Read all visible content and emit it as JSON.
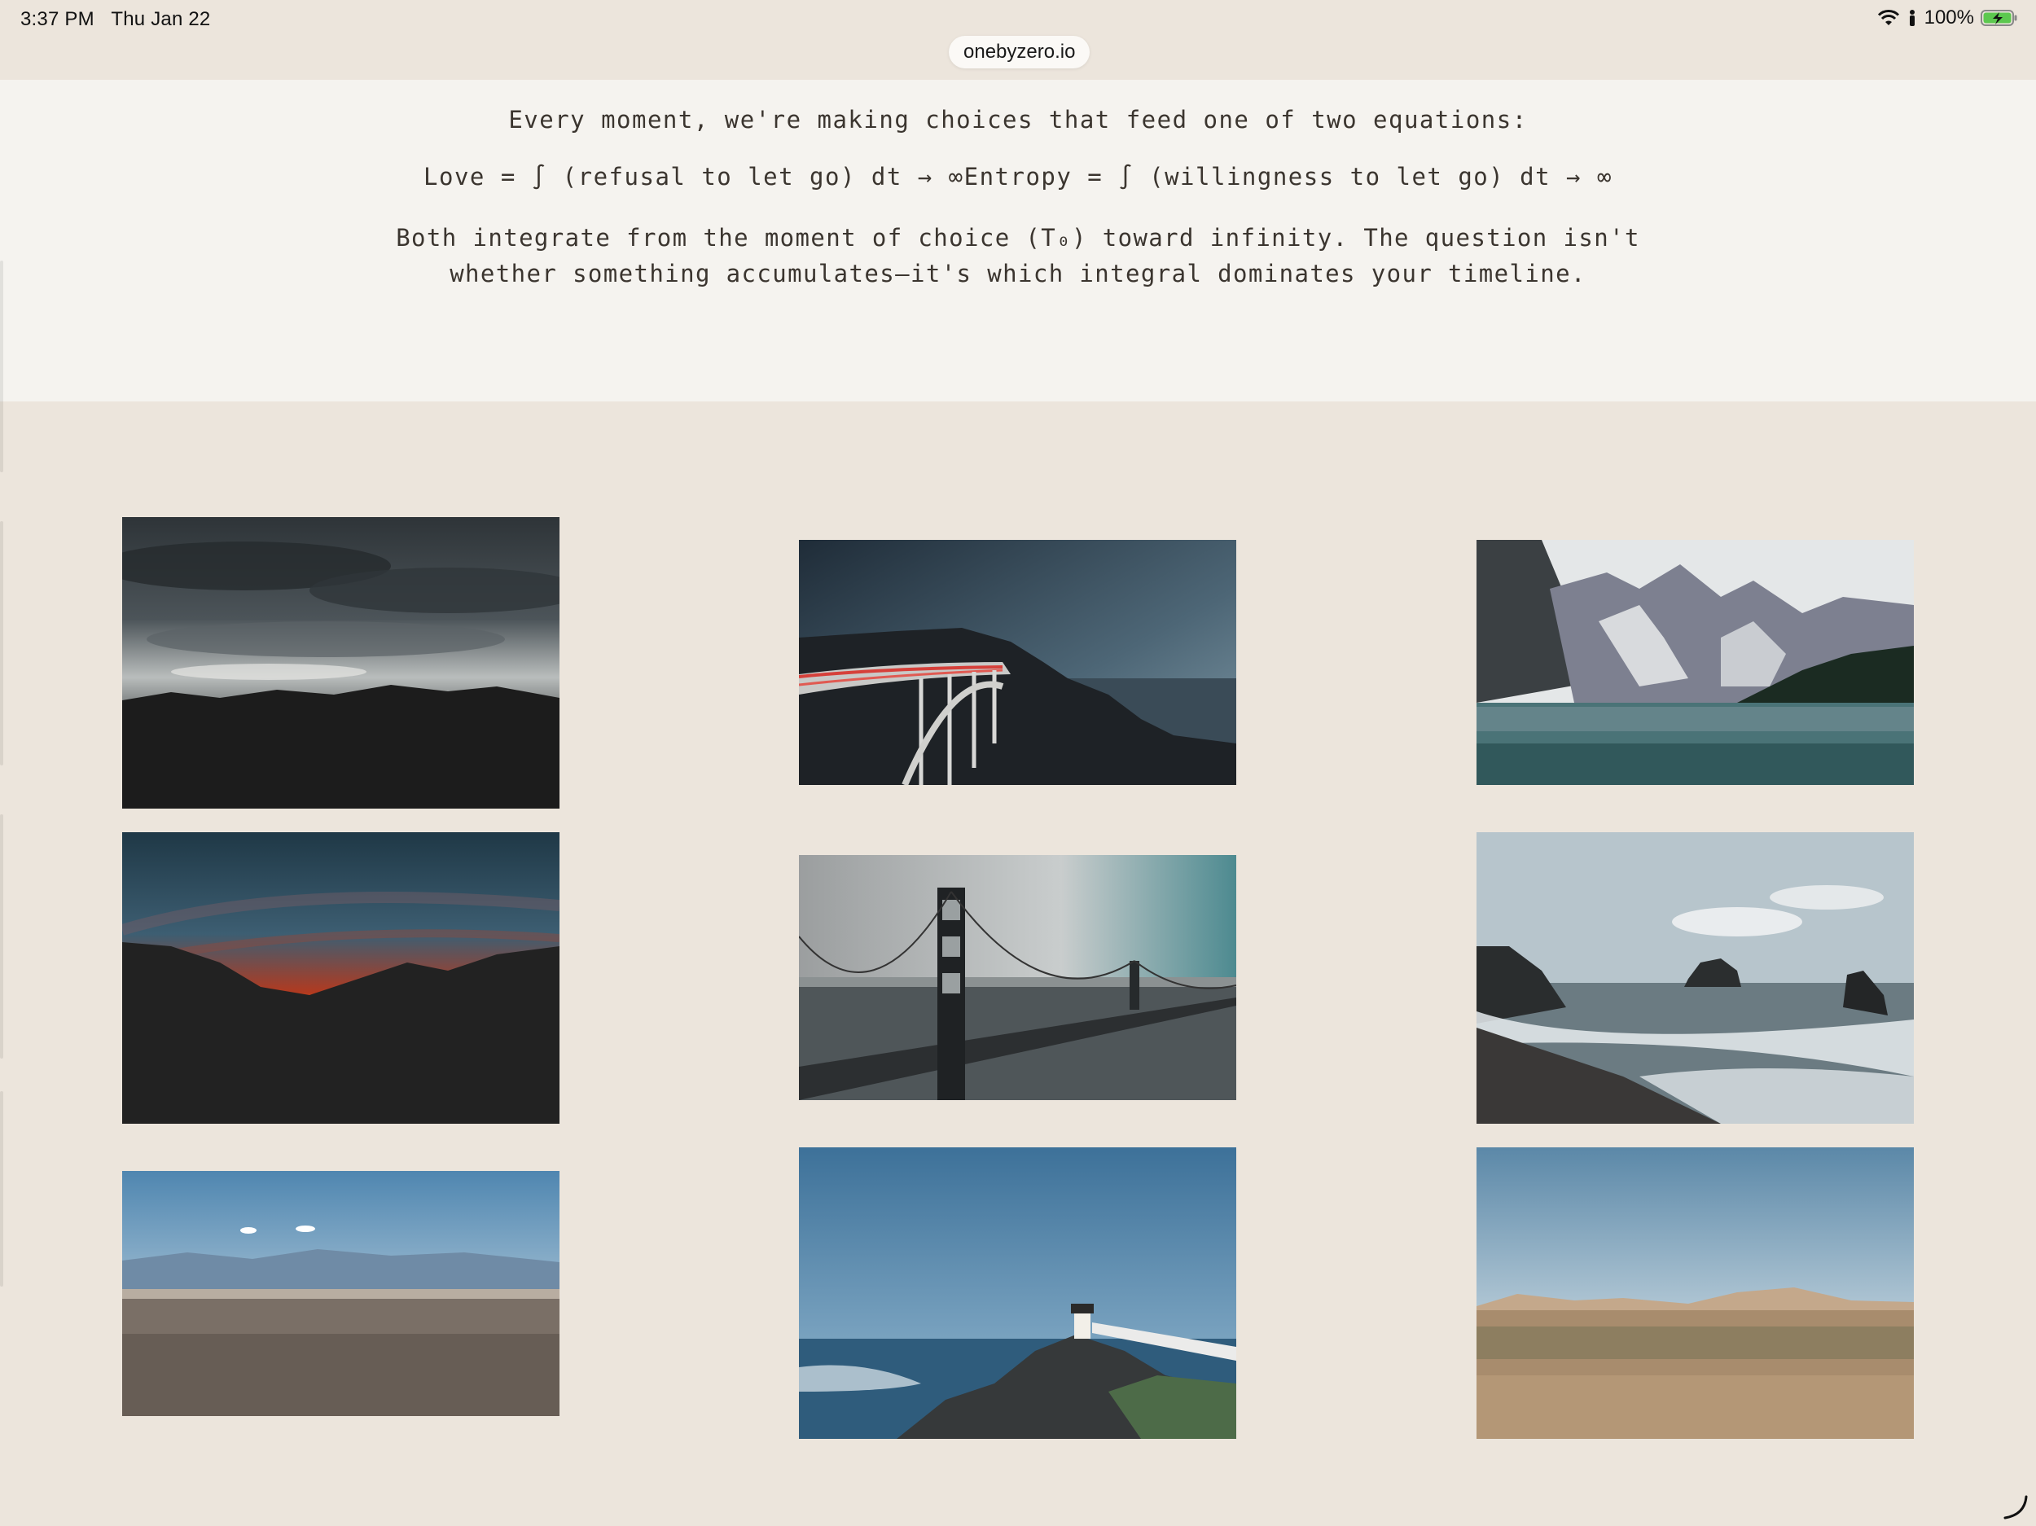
{
  "status_bar": {
    "time": "3:37 PM",
    "date": "Thu Jan 22",
    "battery": "100%",
    "icons": [
      "wifi-icon",
      "person-icon",
      "battery-charging-icon"
    ]
  },
  "browser": {
    "url": "onebyzero.io"
  },
  "content": {
    "intro": "Every moment, we're making choices that feed one of two equations:",
    "equations": "Love = ∫ (refusal to let go) dt → ∞Entropy = ∫ (willingness to let go) dt → ∞",
    "conclusion": "Both integrate from the moment of choice (T₀) toward infinity. The question isn't whether something accumulates—it's which integral dominates your timeline."
  },
  "colors": {
    "page_background": "#ece5dc",
    "text_band_background": "#f5f3ef",
    "text": "#3b352f"
  },
  "gallery": [
    {
      "name": "stormy-sky-silhouette-photo"
    },
    {
      "name": "coastal-bridge-light-trails-photo"
    },
    {
      "name": "mountain-lake-photo"
    },
    {
      "name": "red-sunset-mountains-photo"
    },
    {
      "name": "golden-gate-bridge-photo"
    },
    {
      "name": "rocky-beach-waves-photo"
    },
    {
      "name": "desert-plain-photo"
    },
    {
      "name": "lighthouse-cliff-photo"
    },
    {
      "name": "desert-shrubland-photo"
    }
  ]
}
